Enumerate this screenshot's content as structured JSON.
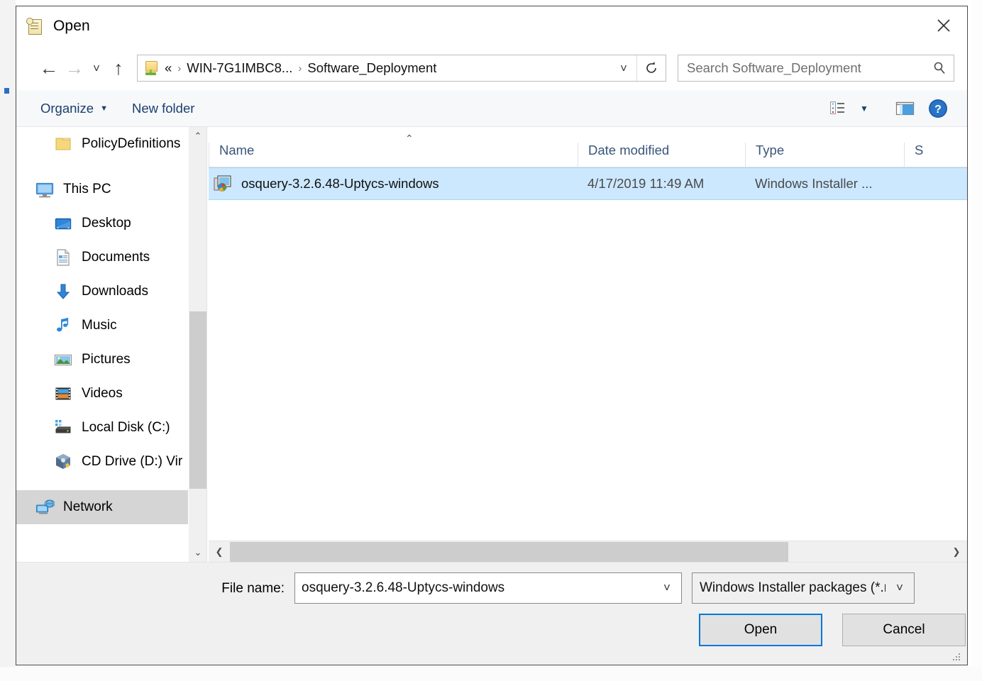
{
  "dialog": {
    "title": "Open",
    "close_label": "×"
  },
  "nav": {
    "back_label": "←",
    "forward_label": "→",
    "recent_label": "˅",
    "up_label": "↑",
    "address_icon": "network-folder-icon",
    "breadcrumbs": [
      {
        "label": "«"
      },
      {
        "label": "WIN-7G1IMBC8..."
      },
      {
        "label": "Software_Deployment"
      }
    ],
    "crumb_separator": "›",
    "dropdown_label": "˅",
    "refresh_label": "↻",
    "search": {
      "placeholder": "Search Software_Deployment",
      "value": "",
      "icon": "search-icon"
    }
  },
  "toolbar": {
    "organize_label": "Organize",
    "organize_caret": "▼",
    "new_folder_label": "New folder",
    "view_icon": "list-view-icon",
    "view_caret": "▼",
    "pane_icon": "preview-pane-icon",
    "help_icon": "help-icon",
    "help_glyph": "?"
  },
  "sidebar": {
    "items": [
      {
        "label": "PolicyDefinitions",
        "icon": "folder-icon",
        "indent": 1,
        "selected": false
      },
      {
        "label": "This PC",
        "icon": "this-pc-icon",
        "indent": 0,
        "selected": false
      },
      {
        "label": "Desktop",
        "icon": "desktop-icon",
        "indent": 1,
        "selected": false
      },
      {
        "label": "Documents",
        "icon": "documents-icon",
        "indent": 1,
        "selected": false
      },
      {
        "label": "Downloads",
        "icon": "downloads-icon",
        "indent": 1,
        "selected": false
      },
      {
        "label": "Music",
        "icon": "music-icon",
        "indent": 1,
        "selected": false
      },
      {
        "label": "Pictures",
        "icon": "pictures-icon",
        "indent": 1,
        "selected": false
      },
      {
        "label": "Videos",
        "icon": "videos-icon",
        "indent": 1,
        "selected": false
      },
      {
        "label": "Local Disk (C:)",
        "icon": "hard-drive-icon",
        "indent": 1,
        "selected": false
      },
      {
        "label": "CD Drive (D:) Vir",
        "icon": "cd-drive-icon",
        "indent": 1,
        "selected": false
      },
      {
        "label": "Network",
        "icon": "network-icon",
        "indent": 0,
        "selected": true
      }
    ],
    "scroll_up": "⌃",
    "scroll_down": "⌄"
  },
  "filelist": {
    "sort_indicator": "⌃",
    "columns": [
      {
        "label": "Name",
        "key": "name"
      },
      {
        "label": "Date modified",
        "key": "date"
      },
      {
        "label": "Type",
        "key": "type"
      },
      {
        "label": "S",
        "key": "size"
      }
    ],
    "rows": [
      {
        "name": "osquery-3.2.6.48-Uptycs-windows",
        "date": "4/17/2019 11:49 AM",
        "type": "Windows Installer ...",
        "size": "",
        "icon": "msi-installer-icon",
        "selected": true
      }
    ],
    "hscroll_left": "❮",
    "hscroll_right": "❯"
  },
  "footer": {
    "filename_label": "File name:",
    "filename_value": "osquery-3.2.6.48-Uptycs-windows",
    "filename_placeholder": "",
    "filename_caret": "˅",
    "filetype_value": "Windows Installer packages (*.r",
    "filetype_caret": "˅",
    "open_label": "Open",
    "cancel_label": "Cancel"
  },
  "colors": {
    "selection_blue": "#cce8ff",
    "accent_blue": "#0078d7",
    "sidebar_selected": "#d5d5d5",
    "toolbar_bg": "#f7f8fa",
    "footer_bg": "#f0f0f0"
  }
}
